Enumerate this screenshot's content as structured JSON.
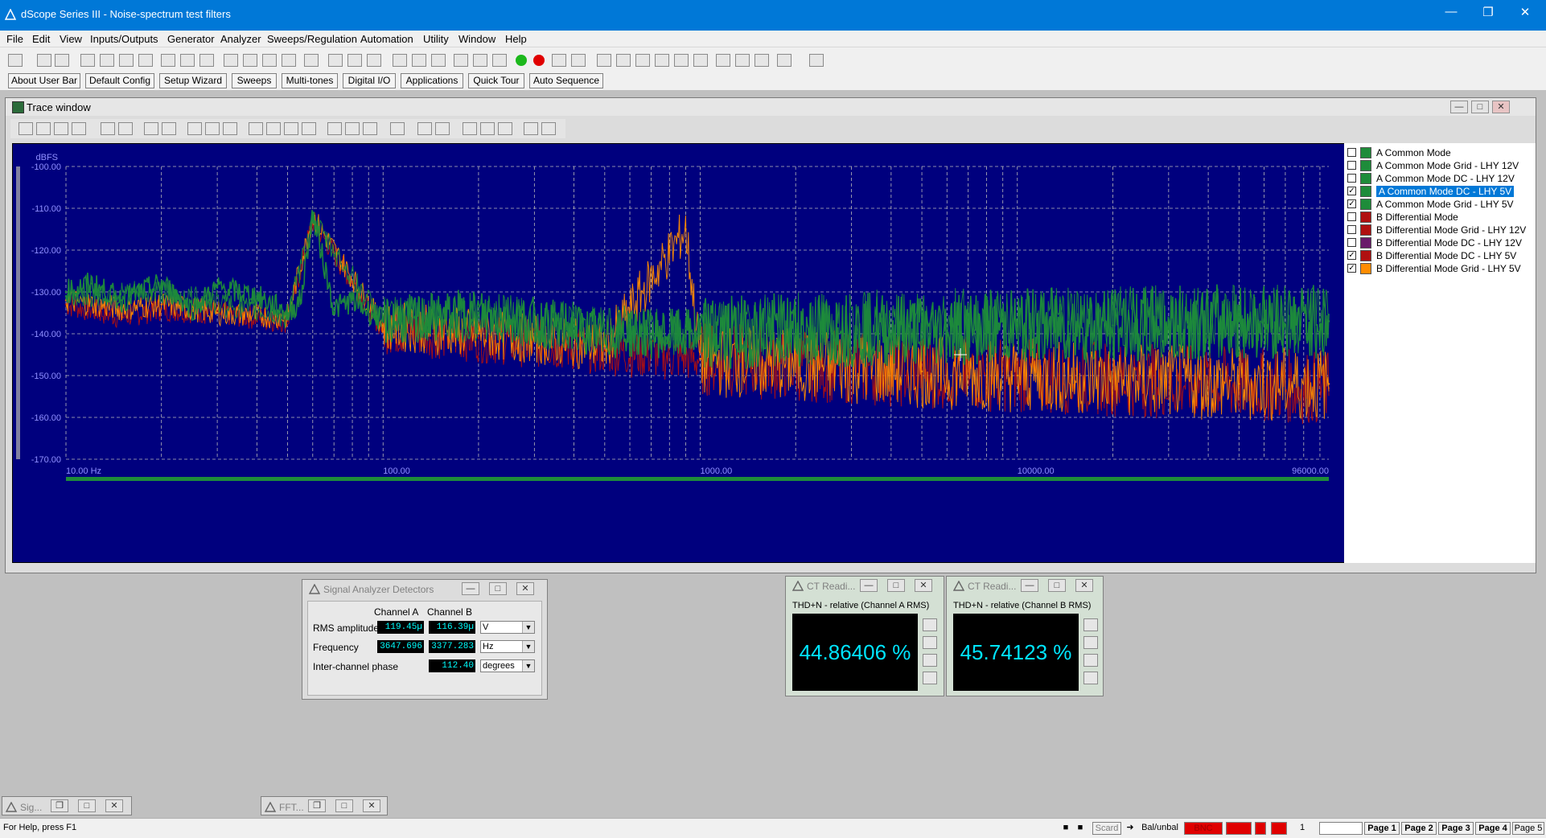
{
  "app": {
    "title": "dScope Series III - Noise-spectrum test filters"
  },
  "menu": [
    "File",
    "Edit",
    "View",
    "Inputs/Outputs",
    "Generator",
    "Analyzer",
    "Sweeps/Regulation",
    "Automation",
    "Utility",
    "Window",
    "Help"
  ],
  "user_bar": [
    "About User Bar",
    "Default Config",
    "Setup Wizard",
    "Sweeps",
    "Multi-tones",
    "Digital I/O",
    "Applications",
    "Quick Tour",
    "Auto Sequence"
  ],
  "trace_window": {
    "title": "Trace window",
    "y_unit": "dBFS",
    "y_ticks": [
      "-100.00",
      "-110.00",
      "-120.00",
      "-130.00",
      "-140.00",
      "-150.00",
      "-160.00",
      "-170.00"
    ],
    "x_ticks": [
      "10.00 Hz",
      "100.00",
      "1000.00",
      "10000.00",
      "96000.00"
    ]
  },
  "legend": [
    {
      "label": "A  Common Mode",
      "checked": false,
      "selected": false,
      "color": "#1e8c3a"
    },
    {
      "label": "A  Common Mode Grid - LHY 12V",
      "checked": false,
      "selected": false,
      "color": "#1e8c3a"
    },
    {
      "label": "A  Common Mode DC - LHY 12V",
      "checked": false,
      "selected": false,
      "color": "#1e8c3a"
    },
    {
      "label": "A  Common Mode DC - LHY 5V",
      "checked": true,
      "selected": true,
      "color": "#1e8c3a"
    },
    {
      "label": "A  Common Mode Grid - LHY 5V",
      "checked": true,
      "selected": false,
      "color": "#1e8c3a"
    },
    {
      "label": "B  Differential Mode",
      "checked": false,
      "selected": false,
      "color": "#b01010"
    },
    {
      "label": "B  Differential Mode Grid - LHY 12V",
      "checked": false,
      "selected": false,
      "color": "#b01010"
    },
    {
      "label": "B  Differential Mode DC - LHY 12V",
      "checked": false,
      "selected": false,
      "color": "#6a1a6a"
    },
    {
      "label": "B  Differential Mode DC - LHY 5V",
      "checked": true,
      "selected": false,
      "color": "#b01010"
    },
    {
      "label": "B  Differential Mode Grid - LHY 5V",
      "checked": true,
      "selected": false,
      "color": "#ff8c00"
    }
  ],
  "detectors": {
    "title": "Signal Analyzer Detectors",
    "col_a": "Channel A",
    "col_b": "Channel B",
    "rows": [
      {
        "label": "RMS amplitude",
        "a": "119.45µ",
        "b": "116.39µ",
        "unit": "V"
      },
      {
        "label": "Frequency",
        "a": "3647.696",
        "b": "3377.283",
        "unit": "Hz"
      },
      {
        "label": "Inter-channel phase",
        "a": "",
        "b": "112.40",
        "unit": "degrees"
      }
    ]
  },
  "ct_a": {
    "title": "CT Readi...",
    "subtitle": "THD+N - relative (Channel A RMS)",
    "value": "44.86406 %"
  },
  "ct_b": {
    "title": "CT Readi...",
    "subtitle": "THD+N - relative (Channel B RMS)",
    "value": "45.74123 %"
  },
  "minimized": [
    "Sig...",
    "FFT..."
  ],
  "status": {
    "help": "For Help, press F1",
    "input": "Bal/unbal",
    "bnc": "BNC",
    "pages": [
      "Page 1",
      "Page 2",
      "Page 3",
      "Page 4",
      "Page 5"
    ],
    "num": "1",
    "scard": "Scard"
  },
  "chart_data": {
    "type": "line",
    "title": "",
    "xlabel": "",
    "ylabel": "dBFS",
    "x_scale": "log",
    "xlim": [
      10,
      96000
    ],
    "ylim": [
      -170,
      -100
    ],
    "grid": true,
    "series": [
      {
        "name": "A  Common Mode DC - LHY 5V",
        "color": "#1e8c3a",
        "x": [
          10,
          12,
          15,
          20,
          25,
          30,
          40,
          50,
          55,
          60,
          70,
          80,
          100,
          150,
          200,
          300,
          500,
          700,
          1000,
          2000,
          5000,
          10000,
          20000,
          50000,
          96000
        ],
        "y": [
          -130,
          -128,
          -132,
          -128,
          -134,
          -129,
          -131,
          -135,
          -132,
          -111,
          -134,
          -132,
          -137,
          -136,
          -135,
          -137,
          -140,
          -140,
          -140,
          -139,
          -139,
          -138,
          -138,
          -137,
          -137
        ]
      },
      {
        "name": "A  Common Mode Grid - LHY 5V",
        "color": "#1e8c3a",
        "x": [
          10,
          20,
          50,
          60,
          100,
          200,
          500,
          1000,
          5000,
          10000,
          50000,
          96000
        ],
        "y": [
          -131,
          -130,
          -136,
          -113,
          -137,
          -136,
          -139,
          -140,
          -138,
          -138,
          -137,
          -137
        ]
      },
      {
        "name": "B  Differential Mode DC - LHY 5V",
        "color": "#b01010",
        "x": [
          10,
          15,
          20,
          30,
          50,
          60,
          100,
          200,
          500,
          1000,
          5000,
          10000,
          50000,
          96000
        ],
        "y": [
          -133,
          -136,
          -134,
          -135,
          -137,
          -113,
          -139,
          -141,
          -144,
          -146,
          -149,
          -150,
          -152,
          -153
        ]
      },
      {
        "name": "B  Differential Mode Grid - LHY 5V",
        "color": "#ff8c00",
        "x": [
          10,
          15,
          20,
          30,
          50,
          60,
          100,
          200,
          500,
          900,
          1000,
          5000,
          10000,
          50000,
          96000
        ],
        "y": [
          -132,
          -134,
          -133,
          -135,
          -136,
          -112,
          -138,
          -140,
          -143,
          -115,
          -146,
          -149,
          -150,
          -152,
          -152
        ]
      }
    ]
  }
}
